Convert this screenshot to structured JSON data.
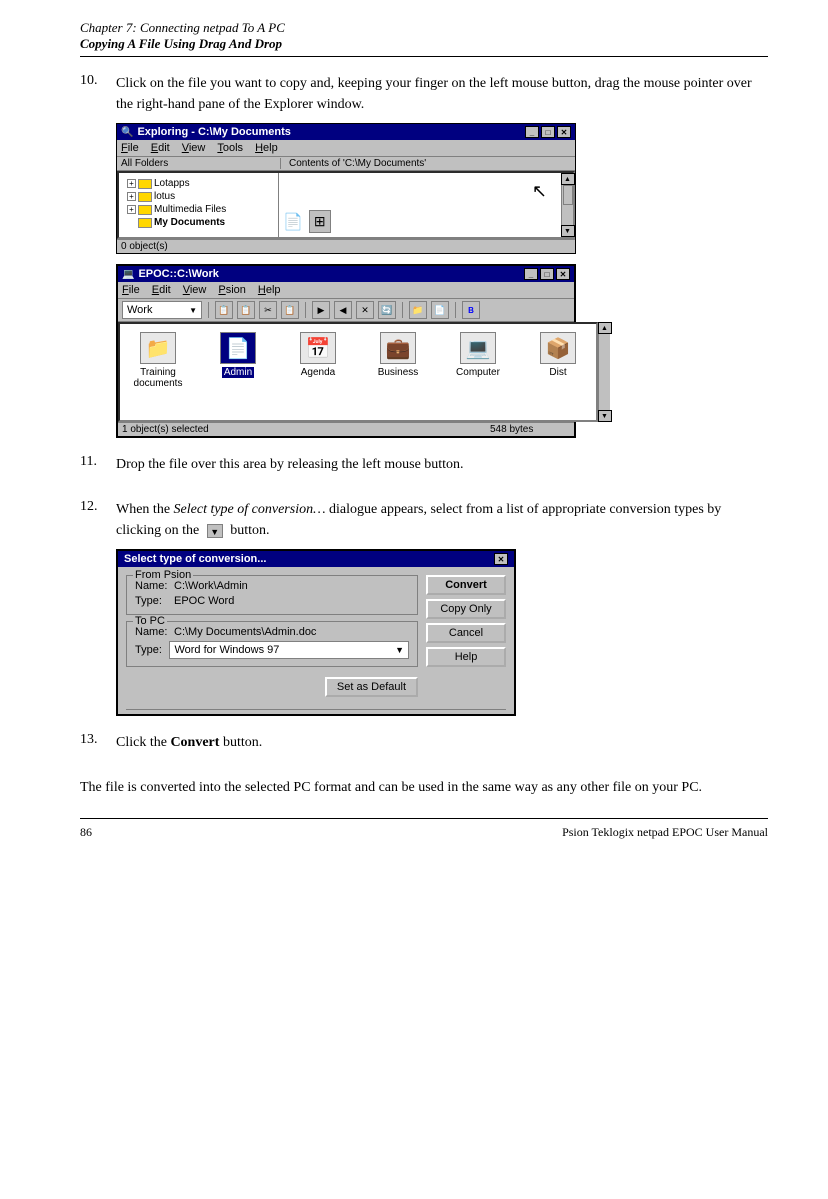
{
  "header": {
    "chapter": "Chapter 7:  Connecting netpad To A PC",
    "section": "Copying A File Using Drag And Drop"
  },
  "step10": {
    "number": "10.",
    "text": "Click on the file you want to copy and, keeping your finger on the left mouse button, drag the mouse pointer over the right-hand pane of the Explorer window."
  },
  "step11": {
    "number": "11.",
    "text": "Drop the file over this area by releasing the left mouse button."
  },
  "step12": {
    "number": "12.",
    "text_before": "When the ",
    "italic": "Select type of conversion…",
    "text_after": " dialogue appears, select from a list of appropriate conversion types by clicking on the",
    "text_end": "button."
  },
  "step13": {
    "number": "13.",
    "text_before": "Click the ",
    "bold": "Convert",
    "text_after": " button."
  },
  "conclusion": "The file is converted into the selected PC format and can be used in the same way as any other file on your PC.",
  "explorer_window": {
    "title": "Exploring - C:\\My Documents",
    "menu": [
      "File",
      "Edit",
      "View",
      "Tools",
      "Help"
    ],
    "left_header": "All Folders",
    "right_header": "Contents of 'C:\\My Documents'",
    "folders": [
      "Lotapps",
      "lotus",
      "Multimedia Files",
      "My Documents"
    ],
    "statusbar": "0 object(s)"
  },
  "epoc_window": {
    "title": "EPOC::C:\\Work",
    "menu": [
      "File",
      "Edit",
      "View",
      "Psion",
      "Help"
    ],
    "dropdown": "Work",
    "icons": [
      {
        "label": "Training\ndocuments",
        "selected": false
      },
      {
        "label": "Admin",
        "selected": true
      },
      {
        "label": "Agenda",
        "selected": false
      },
      {
        "label": "Business",
        "selected": false
      },
      {
        "label": "Computer",
        "selected": false
      },
      {
        "label": "Dist",
        "selected": false
      }
    ],
    "statusbar_left": "1 object(s) selected",
    "statusbar_right": "548 bytes"
  },
  "conversion_dialog": {
    "title": "Select type of conversion...",
    "from_psion_label": "From Psion",
    "from_name_label": "Name:",
    "from_name_value": "C:\\Work\\Admin",
    "from_type_label": "Type:",
    "from_type_value": "EPOC Word",
    "to_pc_label": "To PC",
    "to_name_label": "Name:",
    "to_name_value": "C:\\My Documents\\Admin.doc",
    "to_type_label": "Type:",
    "to_type_value": "Word for Windows 97",
    "buttons": [
      "Convert",
      "Copy Only",
      "Cancel",
      "Help"
    ],
    "set_default_btn": "Set as Default"
  },
  "footer": {
    "page_num": "86",
    "book_title": "Psion Teklogix netpad EPOC User Manual"
  }
}
